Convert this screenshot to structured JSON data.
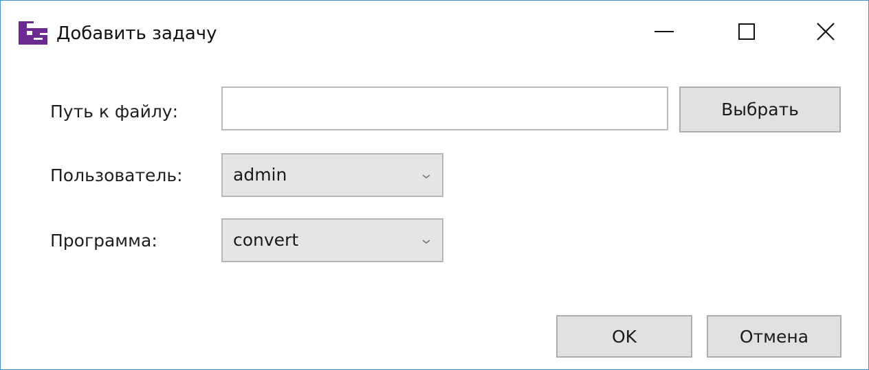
{
  "window": {
    "title": "Добавить задачу",
    "icon": "fs-app-icon",
    "controls": {
      "minimize_icon": "minimize-icon",
      "maximize_icon": "maximize-icon",
      "close_icon": "close-icon"
    }
  },
  "form": {
    "path": {
      "label": "Путь к файлу:",
      "value": "",
      "placeholder": "",
      "browse_label": "Выбрать"
    },
    "user": {
      "label": "Пользователь:",
      "selected": "admin"
    },
    "program": {
      "label": "Программа:",
      "selected": "convert"
    }
  },
  "actions": {
    "ok_label": "OK",
    "cancel_label": "Отмена"
  },
  "colors": {
    "window_border": "#3c8fd6",
    "icon_purple": "#6b2a8f",
    "button_bg": "#e1e1e1",
    "combo_bg": "#e5e5e5"
  }
}
